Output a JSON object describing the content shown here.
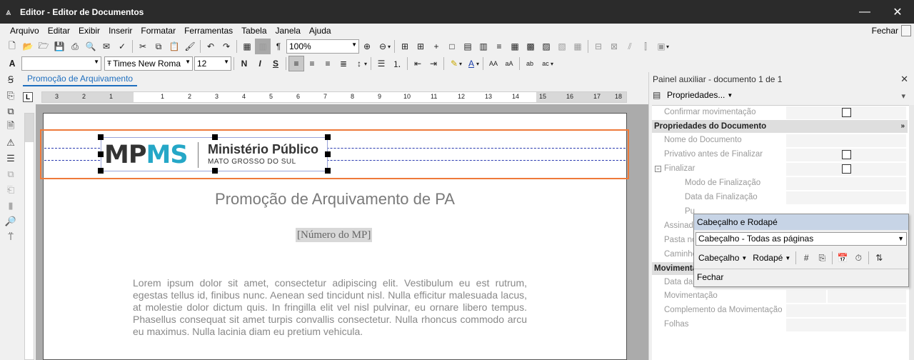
{
  "window": {
    "title": "Editor - Editor de Documentos",
    "minimize": "—",
    "close": "✕"
  },
  "menu": {
    "items": [
      "Arquivo",
      "Editar",
      "Exibir",
      "Inserir",
      "Formatar",
      "Ferramentas",
      "Tabela",
      "Janela",
      "Ajuda"
    ],
    "close_label": "Fechar"
  },
  "toolbar": {
    "zoom": "100%",
    "font_name": "Times New Roma",
    "font_size": "12",
    "style_value": ""
  },
  "document_tab": {
    "label": "Promoção de Arquivamento"
  },
  "ruler": {
    "labels": [
      "3",
      "2",
      "1",
      "1",
      "2",
      "3",
      "4",
      "5",
      "6",
      "7",
      "8",
      "9",
      "10",
      "11",
      "12",
      "13",
      "14",
      "15",
      "16",
      "17",
      "18"
    ]
  },
  "document": {
    "logo_mp": "MP",
    "logo_ms": "MS",
    "logo_name": "Ministério Público",
    "logo_sub": "MATO GROSSO DO SUL",
    "title": "Promoção de Arquivamento de PA",
    "number_placeholder": "[Número do MP]",
    "body": "Lorem ipsum dolor sit amet, consectetur adipiscing elit. Vestibulum eu est rutrum, egestas tellus id, finibus nunc. Aenean sed tincidunt nisl. Nulla efficitur malesuada lacus, at molestie dolor dictum quis. In fringilla elit vel nisl pulvinar, eu ornare libero tempus. Phasellus consequat sit amet turpis convallis consectetur. Nulla rhoncus commodo arcu eu maximus. Nulla lacinia diam eu pretium vehicula."
  },
  "aux_panel": {
    "title": "Painel auxiliar - documento 1 de 1",
    "properties_button": "Propriedades...",
    "rows": {
      "confirmar": "Confirmar movimentação",
      "category_doc": "Propriedades do Documento",
      "nome": "Nome do Documento",
      "privativo": "Privativo antes de Finalizar",
      "finalizar": "Finalizar",
      "modo": "Modo de Finalização",
      "data_final": "Data da Finalização",
      "pu": "Pu",
      "assinad": "Assinad",
      "pasta": "Pasta no",
      "caminho": "Caminho",
      "category_mov": "Movimenta",
      "data_mov": "Data da",
      "movimentacao": "Movimentação",
      "complemento": "Complemento da Movimentação",
      "folhas": "Folhas"
    }
  },
  "popup": {
    "title": "Cabeçalho e Rodapé",
    "select_value": "Cabeçalho -  Todas as páginas",
    "header_btn": "Cabeçalho",
    "footer_btn": "Rodapé",
    "close_label": "Fechar"
  },
  "colors": {
    "titlebar": "#2b2b2b",
    "accent_tab": "#1f6fbf",
    "header_border": "#ee7a3a",
    "logo_ms": "#25a7c7",
    "popup_header": "#c7d4e6"
  }
}
